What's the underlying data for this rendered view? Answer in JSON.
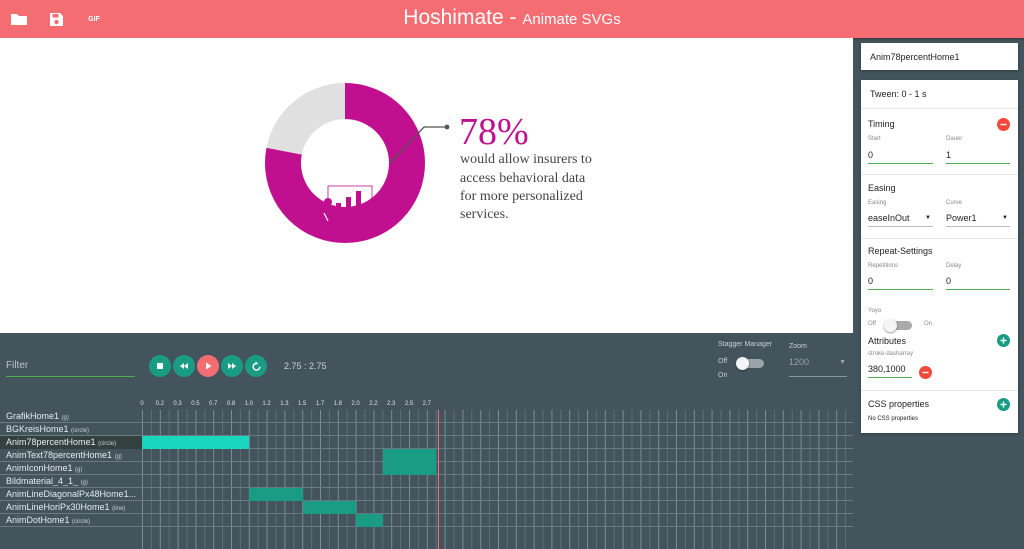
{
  "header": {
    "title": "Hoshimate",
    "separator": " - ",
    "subtitle": "Animate SVGs",
    "icons": {
      "open": "folder-icon",
      "save": "save-icon",
      "gif": "GIF"
    }
  },
  "stage": {
    "percent": "78%",
    "text_lines": [
      "would allow insurers to",
      "access behavioral data",
      "for more personalized",
      "services."
    ],
    "donut_fraction": 0.78,
    "colors": {
      "accent": "#c1108f",
      "rest": "#e0e0e0"
    }
  },
  "controls": {
    "filter_placeholder": "Filter",
    "time": "2.75 : 2.75",
    "stagger_label": "Stagger Manager",
    "stagger_off": "Off",
    "stagger_on": "On",
    "zoom_label": "Zoom",
    "zoom_value": "1200"
  },
  "timeline": {
    "ticks": [
      "0",
      "0.2",
      "0.3",
      "0.5",
      "0.7",
      "0.8",
      "1.0",
      "1.2",
      "1.3",
      "1.5",
      "1.7",
      "1.8",
      "2.0",
      "2.2",
      "2.3",
      "2.5",
      "2.7"
    ],
    "rows": [
      {
        "name": "GrafikHome1",
        "kind": "(g)",
        "start": null,
        "end": null
      },
      {
        "name": "BGKreisHome1",
        "kind": "(circle)",
        "start": null,
        "end": null
      },
      {
        "name": "Anim78percentHome1",
        "kind": "(circle)",
        "start": 0,
        "end": 1,
        "selected": true
      },
      {
        "name": "AnimText78percentHome1",
        "kind": "(g)",
        "start": 2.25,
        "end": 2.75
      },
      {
        "name": "AnimIconHome1",
        "kind": "(g)",
        "start": 2.25,
        "end": 2.75
      },
      {
        "name": "Bildmaterial_4_1_",
        "kind": "(g)",
        "start": null,
        "end": null
      },
      {
        "name": "AnimLineDiagonalPx48Home1...",
        "kind": "",
        "start": 1,
        "end": 1.5
      },
      {
        "name": "AnimLineHoriPx30Home1",
        "kind": "(line)",
        "start": 1.5,
        "end": 2
      },
      {
        "name": "AnimDotHome1",
        "kind": "(circle)",
        "start": 2,
        "end": 2.25
      }
    ],
    "playhead_time": 2.75
  },
  "panel": {
    "element_name": "Anim78percentHome1",
    "tween": "Tween: 0 - 1 s",
    "timing_title": "Timing",
    "start_label": "Start",
    "start_value": "0",
    "duration_label": "Dauer",
    "duration_value": "1",
    "easing_title": "Easing",
    "easing_label": "Easing",
    "easing_value": "easeInOut",
    "curve_label": "Curve",
    "curve_value": "Power1",
    "repeat_title": "Repeat-Settings",
    "repetitions_label": "Repetitions",
    "repetitions_value": "0",
    "delay_label": "Delay",
    "delay_value": "0",
    "yoyo_label": "Yoyo",
    "yoyo_off": "Off",
    "yoyo_on": "On",
    "attributes_title": "Attributes",
    "attribute_name": "stroke-dasharray",
    "attribute_value": "380,1000",
    "css_title": "CSS properties",
    "css_empty": "No CSS properties"
  }
}
